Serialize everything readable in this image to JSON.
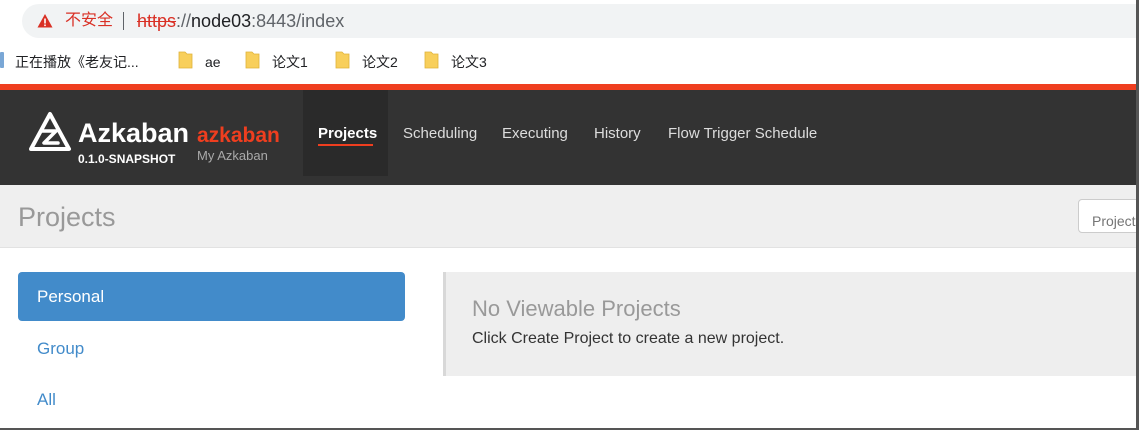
{
  "browser": {
    "security_label": "不安全",
    "url_scheme": "https",
    "url_sep": "://",
    "url_host": "node03",
    "url_rest": ":8443/index"
  },
  "bookmarks": {
    "items": [
      "正在播放《老友记...",
      "ae",
      "论文1",
      "论文2",
      "论文3"
    ]
  },
  "navbar": {
    "brand": "Azkaban",
    "brand_name": "azkaban",
    "version": "0.1.0-SNAPSHOT",
    "subtitle": "My Azkaban",
    "links": [
      "Projects",
      "Scheduling",
      "Executing",
      "History",
      "Flow Trigger Schedule"
    ],
    "active": "Projects"
  },
  "page": {
    "title": "Projects",
    "search_placeholder": "Project"
  },
  "sidebar": {
    "items": [
      "Personal",
      "Group",
      "All"
    ],
    "active": "Personal"
  },
  "empty_state": {
    "title": "No Viewable Projects",
    "message": "Click Create Project to create a new project."
  },
  "colors": {
    "accent": "#ef3e1f",
    "navbar_bg": "#333333",
    "link_blue": "#428bca",
    "warning_red": "#d93025"
  }
}
